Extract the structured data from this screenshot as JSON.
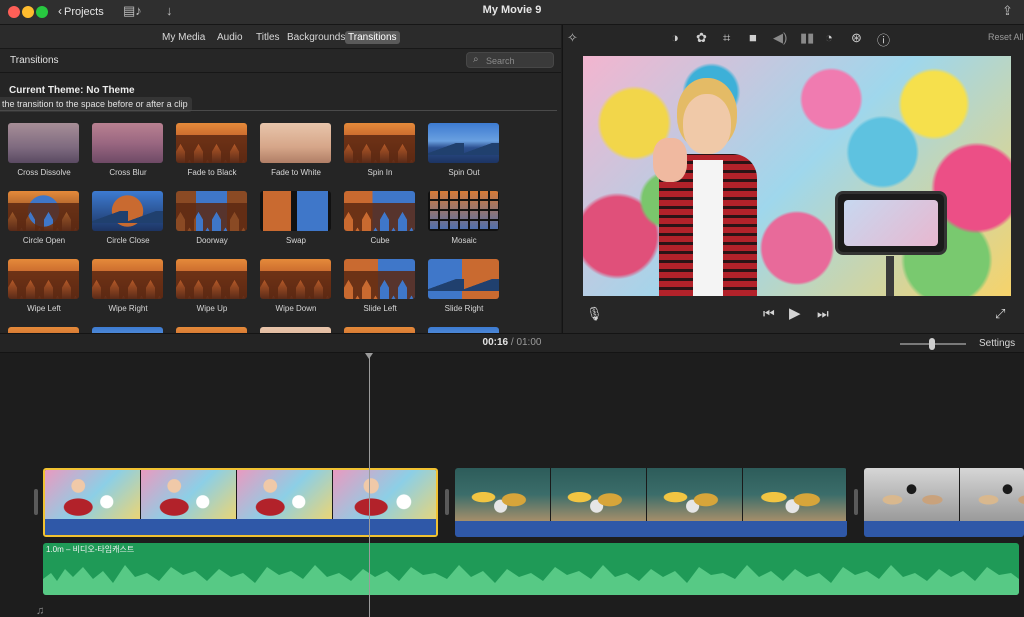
{
  "window": {
    "title": "My Movie 9",
    "back_label": "Projects"
  },
  "browser": {
    "tabs": [
      {
        "label": "My Media"
      },
      {
        "label": "Audio"
      },
      {
        "label": "Titles"
      },
      {
        "label": "Backgrounds"
      },
      {
        "label": "Transitions",
        "active": true
      }
    ],
    "panel_title": "Transitions",
    "search_placeholder": "Search",
    "theme_label": "Current Theme: No Theme",
    "hint": "the transition to the space before or after a clip",
    "transitions": [
      {
        "label": "Cross Dissolve"
      },
      {
        "label": "Cross Blur"
      },
      {
        "label": "Fade to Black"
      },
      {
        "label": "Fade to White"
      },
      {
        "label": "Spin In"
      },
      {
        "label": "Spin Out"
      },
      {
        "label": "Circle Open"
      },
      {
        "label": "Circle Close"
      },
      {
        "label": "Doorway"
      },
      {
        "label": "Swap"
      },
      {
        "label": "Cube"
      },
      {
        "label": "Mosaic"
      },
      {
        "label": "Wipe Left"
      },
      {
        "label": "Wipe Right"
      },
      {
        "label": "Wipe Up"
      },
      {
        "label": "Wipe Down"
      },
      {
        "label": "Slide Left"
      },
      {
        "label": "Slide Right"
      }
    ]
  },
  "viewer": {
    "reset_label": "Reset All",
    "tools": [
      "color-balance-icon",
      "color-correction-icon",
      "crop-icon",
      "stabilization-icon",
      "volume-icon",
      "noise-reduction-icon",
      "speed-icon",
      "filter-icon",
      "info-icon"
    ]
  },
  "timeline": {
    "current_time": "00:16",
    "separator": "/",
    "total_time": "01:00",
    "settings_label": "Settings",
    "audio_label": "1.0m – 비디오-타임캐스트"
  },
  "colors": {
    "accent_selected": "#f1c232",
    "clip_bar": "#2f58a8",
    "audio_track": "#1f9a57"
  }
}
